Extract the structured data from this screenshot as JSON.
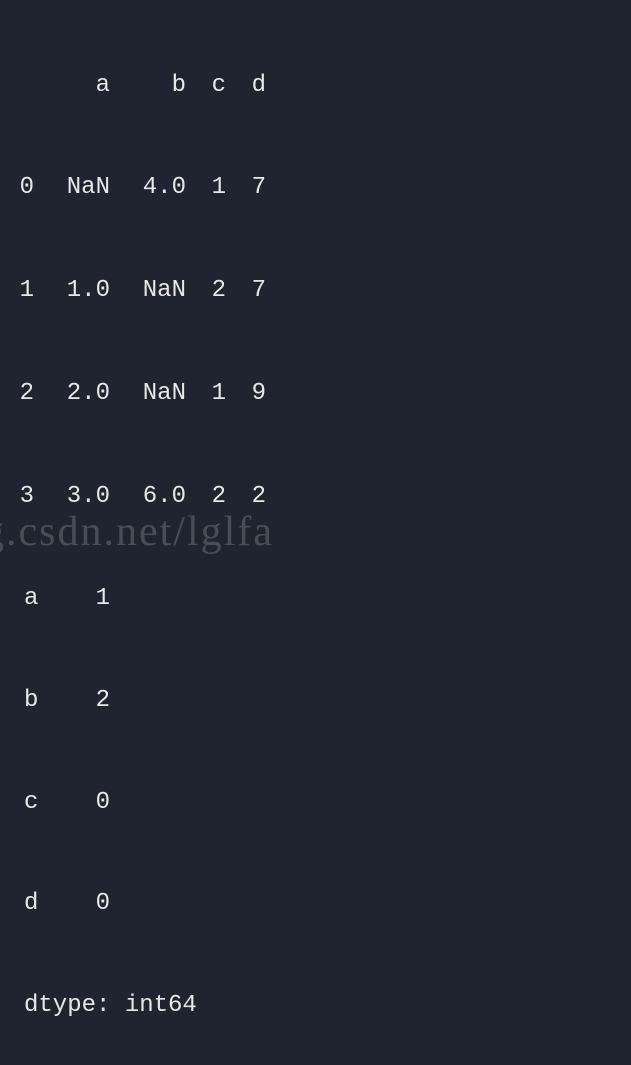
{
  "chart_data": {
    "type": "table",
    "columns": [
      "a",
      "b",
      "c",
      "d"
    ],
    "index": [
      "0",
      "1",
      "2",
      "3"
    ],
    "rows": [
      [
        "NaN",
        "4.0",
        "1",
        "7"
      ],
      [
        "1.0",
        "NaN",
        "2",
        "7"
      ],
      [
        "2.0",
        "NaN",
        "1",
        "9"
      ],
      [
        "3.0",
        "6.0",
        "2",
        "2"
      ]
    ],
    "nan_counts": {
      "a": 1,
      "b": 2,
      "c": 0,
      "d": 0
    },
    "dtype": "int64"
  },
  "header": {
    "blank": "",
    "a": "a",
    "b": "b",
    "c": "c",
    "d": "d"
  },
  "rows": [
    {
      "idx": "0",
      "a": "NaN",
      "b": "4.0",
      "c": "1",
      "d": "7"
    },
    {
      "idx": "1",
      "a": "1.0",
      "b": "NaN",
      "c": "2",
      "d": "7"
    },
    {
      "idx": "2",
      "a": "2.0",
      "b": "NaN",
      "c": "1",
      "d": "9"
    },
    {
      "idx": "3",
      "a": "3.0",
      "b": "6.0",
      "c": "2",
      "d": "2"
    }
  ],
  "summary": [
    {
      "label": "a",
      "value": "1"
    },
    {
      "label": "b",
      "value": "2"
    },
    {
      "label": "c",
      "value": "0"
    },
    {
      "label": "d",
      "value": "0"
    }
  ],
  "dtype_line": "dtype: int64",
  "watermark": "og.csdn.net/lglfa"
}
